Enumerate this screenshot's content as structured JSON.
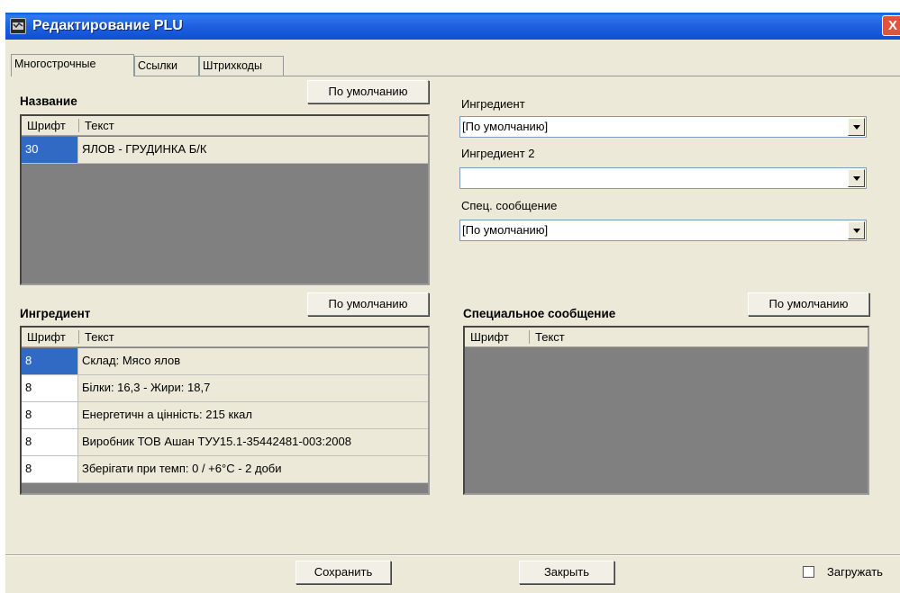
{
  "window": {
    "title": "Редактирование PLU",
    "close_symbol": "X"
  },
  "tabs": [
    {
      "label": "Многострочные",
      "active": true
    },
    {
      "label": "Ссылки",
      "active": false
    },
    {
      "label": "Штрихкоды",
      "active": false
    }
  ],
  "name_section": {
    "label": "Название",
    "default_button": "По умолчанию",
    "columns": [
      "Шрифт",
      "Текст"
    ],
    "rows": [
      {
        "font": "30",
        "text": "ЯЛОВ - ГРУДИНКА Б/К",
        "selected": true
      }
    ]
  },
  "ingredient_section": {
    "label": "Ингредиент",
    "default_button": "По умолчанию",
    "columns": [
      "Шрифт",
      "Текст"
    ],
    "rows": [
      {
        "font": "8",
        "text": "Склад: Мясо ялов",
        "selected": true
      },
      {
        "font": "8",
        "text": "Білки: 16,3 - Жири: 18,7",
        "selected": false
      },
      {
        "font": "8",
        "text": "Енергетичн а цінність: 215 ккал",
        "selected": false
      },
      {
        "font": "8",
        "text": "Виробник ТОВ Ашан ТУУ15.1-35442481-003:2008",
        "selected": false
      },
      {
        "font": "8",
        "text": "Зберігати при темп: 0 / +6°С - 2 доби",
        "selected": false
      }
    ]
  },
  "right_fields": {
    "ingredient": {
      "label": "Ингредиент",
      "value": "[По умолчанию]"
    },
    "ingredient2": {
      "label": "Ингредиент 2",
      "value": ""
    },
    "special": {
      "label": "Спец. сообщение",
      "value": "[По умолчанию]"
    }
  },
  "special_section": {
    "label": "Специальное сообщение",
    "default_button": "По умолчанию",
    "columns": [
      "Шрифт",
      "Текст"
    ]
  },
  "footer": {
    "save_label": "Сохранить",
    "close_label": "Закрыть",
    "load_label": "Загружать",
    "load_checked": false
  },
  "colors": {
    "titlebar": "#1f63e0",
    "selection": "#316ac5",
    "window_bg": "#ece9d8",
    "grid_empty": "#808080"
  }
}
